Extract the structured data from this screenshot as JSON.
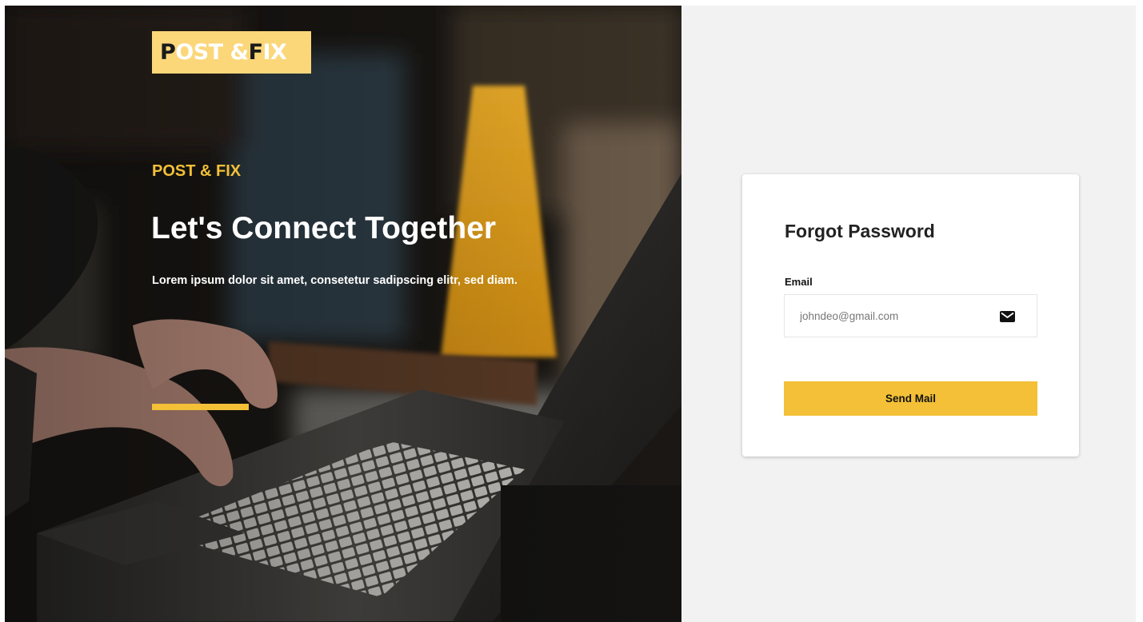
{
  "logo": {
    "first_letter": "P",
    "part1": "OST & ",
    "dark_letter2": "F",
    "part2": "IX"
  },
  "hero": {
    "brand": "POST & FIX",
    "headline": "Let's Connect Together",
    "lead": "Lorem ipsum dolor sit amet, consetetur sadipscing elitr, sed diam."
  },
  "card": {
    "title": "Forgot Password",
    "email_label": "Email",
    "email_placeholder": "johndeo@gmail.com",
    "email_value": "",
    "email_icon": "mail-icon",
    "submit_label": "Send Mail"
  },
  "colors": {
    "accent": "#f3c037",
    "logo_bg": "#fbd77a",
    "panel_bg": "#f2f2f2"
  }
}
